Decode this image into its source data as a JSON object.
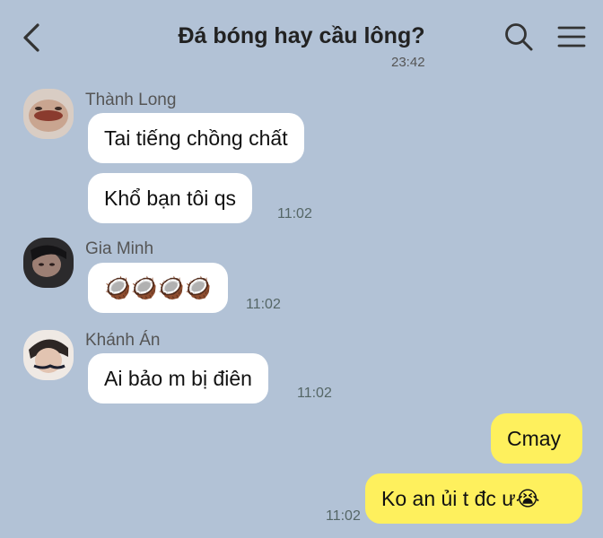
{
  "header": {
    "title": "Đá bóng hay cầu lông?",
    "partial_time": "23:42",
    "icons": [
      "back-chevron-icon",
      "search-icon",
      "menu-icon"
    ]
  },
  "messages": [
    {
      "sender": "Thành Long",
      "texts": [
        "Tai tiếng chồng chất",
        "Khổ bạn tôi qs"
      ],
      "time": "11:02"
    },
    {
      "sender": "Gia Minh",
      "emoji": "🥥🥥🥥🥥",
      "time": "11:02"
    },
    {
      "sender": "Khánh Án",
      "texts": [
        "Ai bảo m bị điên"
      ],
      "time": "11:02"
    }
  ],
  "mine": {
    "texts": [
      "Cmay",
      "Ko an ủi t đc ư😭"
    ],
    "time": "11:02"
  },
  "colors": {
    "background": "#b2c2d6",
    "incoming_bubble": "#ffffff",
    "outgoing_bubble": "#fef05d"
  }
}
